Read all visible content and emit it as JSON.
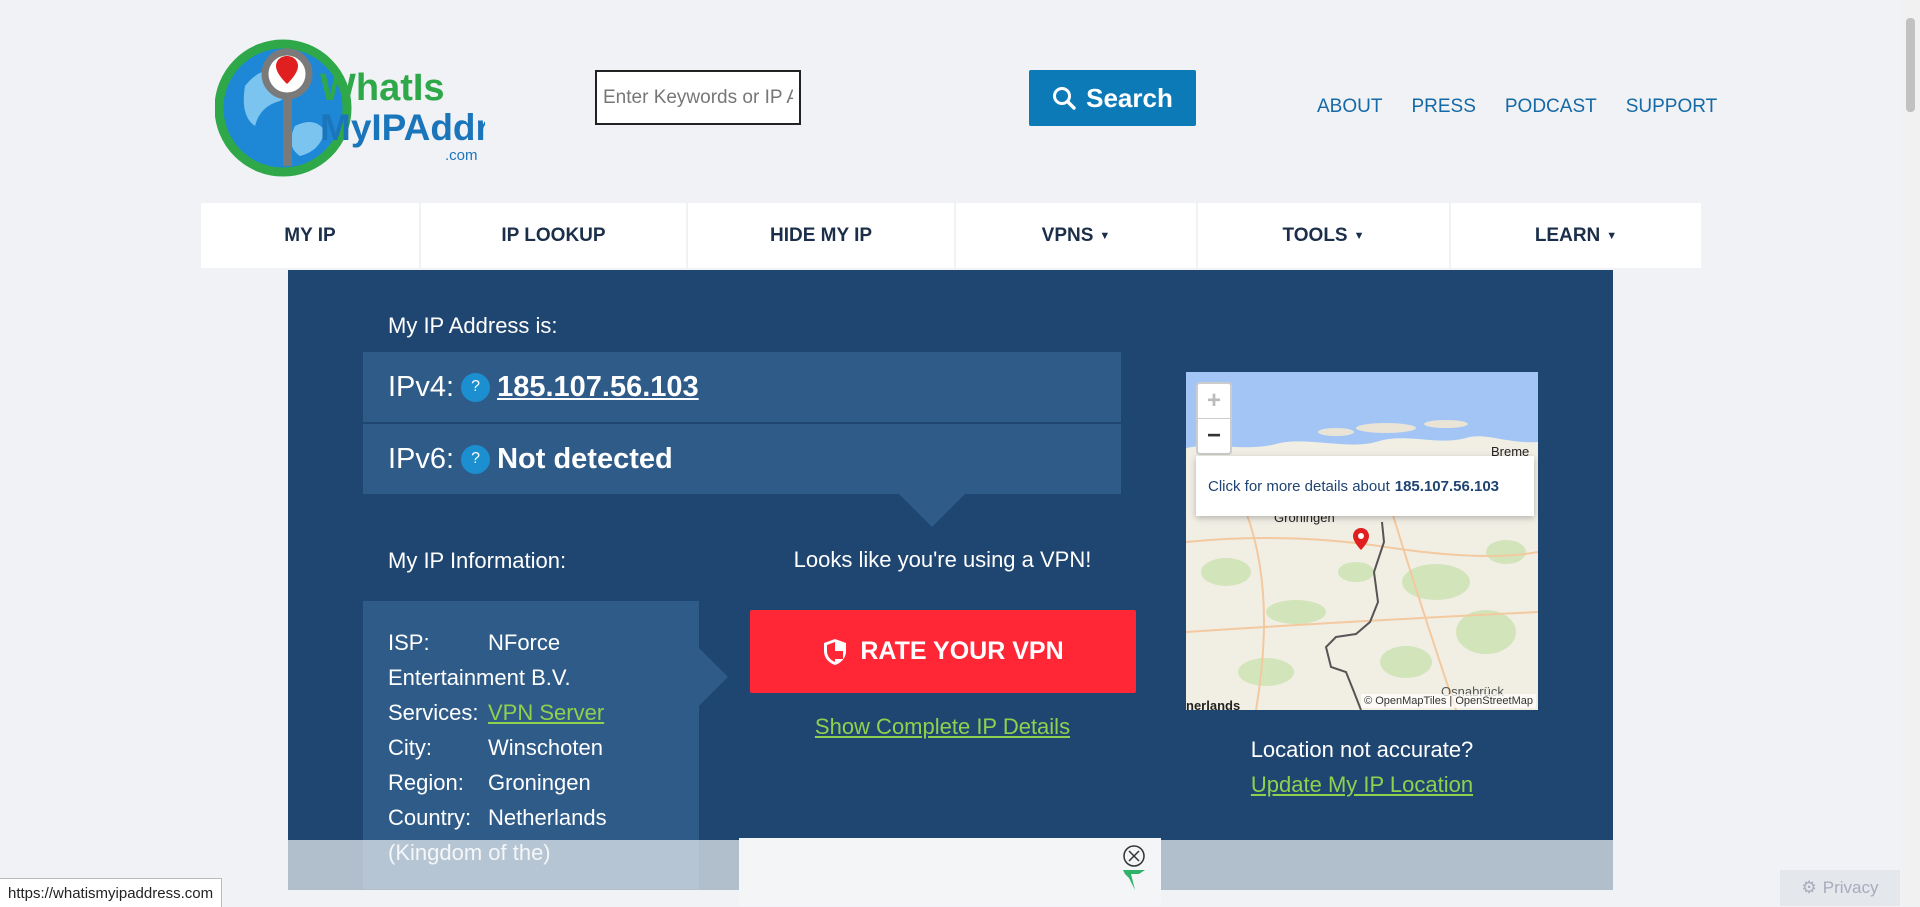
{
  "logo": {
    "line1": "WhatIs",
    "line2": "MyIPAddress",
    "line3": ".com"
  },
  "search": {
    "placeholder": "Enter Keywords or IP Address",
    "button_label": "Search"
  },
  "top_links": [
    "ABOUT",
    "PRESS",
    "PODCAST",
    "SUPPORT"
  ],
  "main_nav": [
    {
      "label": "MY IP",
      "has_dropdown": false
    },
    {
      "label": "IP LOOKUP",
      "has_dropdown": false
    },
    {
      "label": "HIDE MY IP",
      "has_dropdown": false
    },
    {
      "label": "VPNS",
      "has_dropdown": true
    },
    {
      "label": "TOOLS",
      "has_dropdown": true
    },
    {
      "label": "LEARN",
      "has_dropdown": true
    }
  ],
  "ip": {
    "heading": "My IP Address is:",
    "ipv4_label": "IPv4:",
    "ipv4_value": "185.107.56.103",
    "ipv6_label": "IPv6:",
    "ipv6_value": "Not detected",
    "help_glyph": "?"
  },
  "info": {
    "heading": "My IP Information:",
    "isp_label": "ISP:",
    "isp_value": "NForce Entertainment B.V.",
    "services_label": "Services:",
    "services_value": "VPN Server",
    "city_label": "City:",
    "city_value": "Winschoten",
    "region_label": "Region:",
    "region_value": "Groningen",
    "country_label": "Country:",
    "country_value": "Netherlands (Kingdom of the)"
  },
  "vpn": {
    "message": "Looks like you're using a VPN!",
    "rate_button": "RATE YOUR VPN",
    "details_link": "Show Complete IP Details"
  },
  "map": {
    "zoom_in": "+",
    "zoom_out": "−",
    "popup_text": "Click for more details about",
    "popup_ip": "185.107.56.103",
    "city_label": "Groningen",
    "city_label_2": "Breme",
    "city_label_3": "Osnabrück",
    "city_label_4": "nerlands",
    "attribution": "© OpenMapTiles | OpenStreetMap"
  },
  "location": {
    "question": "Location not accurate?",
    "update_link": "Update My IP Location"
  },
  "status_bar": {
    "url": "https://whatismyipaddress.com"
  },
  "privacy_label": "Privacy",
  "colors": {
    "brand_blue": "#1f4671",
    "accent_red": "#ff2636",
    "link_green": "#8fd14f",
    "search_blue": "#0d7ab8"
  }
}
